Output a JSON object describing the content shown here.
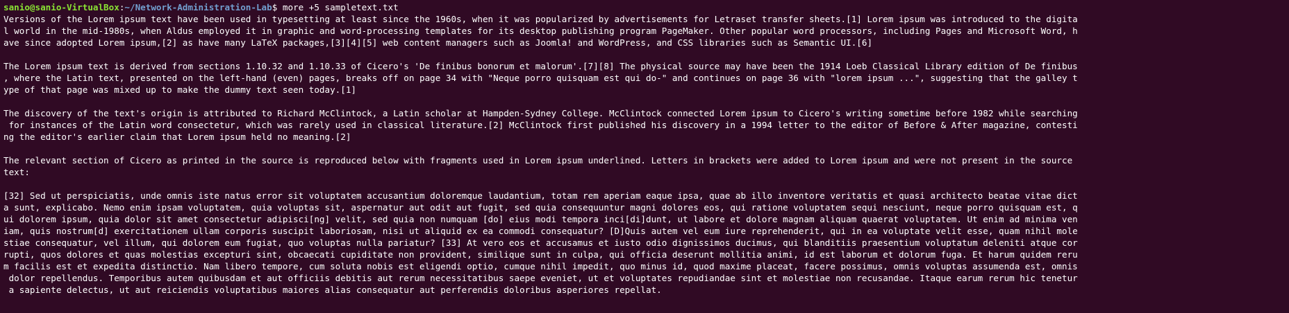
{
  "terminal": {
    "prompt": {
      "user_host": "sanio@sanio-VirtualBox",
      "separator": ":",
      "path": "~/Network-Administration-Lab",
      "dollar": "$ ",
      "command": "more +5 sampletext.txt"
    },
    "output_lines": [
      "Versions of the Lorem ipsum text have been used in typesetting at least since the 1960s, when it was popularized by advertisements for Letraset transfer sheets.[1] Lorem ipsum was introduced to the digita",
      "l world in the mid-1980s, when Aldus employed it in graphic and word-processing templates for its desktop publishing program PageMaker. Other popular word processors, including Pages and Microsoft Word, h",
      "ave since adopted Lorem ipsum,[2] as have many LaTeX packages,[3][4][5] web content managers such as Joomla! and WordPress, and CSS libraries such as Semantic UI.[6]",
      "",
      "The Lorem ipsum text is derived from sections 1.10.32 and 1.10.33 of Cicero's 'De finibus bonorum et malorum'.[7][8] The physical source may have been the 1914 Loeb Classical Library edition of De finibus",
      ", where the Latin text, presented on the left-hand (even) pages, breaks off on page 34 with \"Neque porro quisquam est qui do-\" and continues on page 36 with \"lorem ipsum ...\", suggesting that the galley t",
      "ype of that page was mixed up to make the dummy text seen today.[1]",
      "",
      "The discovery of the text's origin is attributed to Richard McClintock, a Latin scholar at Hampden-Sydney College. McClintock connected Lorem ipsum to Cicero's writing sometime before 1982 while searching",
      " for instances of the Latin word consectetur, which was rarely used in classical literature.[2] McClintock first published his discovery in a 1994 letter to the editor of Before & After magazine, contesti",
      "ng the editor's earlier claim that Lorem ipsum held no meaning.[2]",
      "",
      "The relevant section of Cicero as printed in the source is reproduced below with fragments used in Lorem ipsum underlined. Letters in brackets were added to Lorem ipsum and were not present in the source",
      "text:",
      "",
      "[32] Sed ut perspiciatis, unde omnis iste natus error sit voluptatem accusantium doloremque laudantium, totam rem aperiam eaque ipsa, quae ab illo inventore veritatis et quasi architecto beatae vitae dict",
      "a sunt, explicabo. Nemo enim ipsam voluptatem, quia voluptas sit, aspernatur aut odit aut fugit, sed quia consequuntur magni dolores eos, qui ratione voluptatem sequi nesciunt, neque porro quisquam est, q",
      "ui dolorem ipsum, quia dolor sit amet consectetur adipisci[ng] velit, sed quia non numquam [do] eius modi tempora inci[di]dunt, ut labore et dolore magnam aliquam quaerat voluptatem. Ut enim ad minima ven",
      "iam, quis nostrum[d] exercitationem ullam corporis suscipit laboriosam, nisi ut aliquid ex ea commodi consequatur? [D]Quis autem vel eum iure reprehenderit, qui in ea voluptate velit esse, quam nihil mole",
      "stiae consequatur, vel illum, qui dolorem eum fugiat, quo voluptas nulla pariatur? [33] At vero eos et accusamus et iusto odio dignissimos ducimus, qui blanditiis praesentium voluptatum deleniti atque cor",
      "rupti, quos dolores et quas molestias excepturi sint, obcaecati cupiditate non provident, similique sunt in culpa, qui officia deserunt mollitia animi, id est laborum et dolorum fuga. Et harum quidem reru",
      "m facilis est et expedita distinctio. Nam libero tempore, cum soluta nobis est eligendi optio, cumque nihil impedit, quo minus id, quod maxime placeat, facere possimus, omnis voluptas assumenda est, omnis",
      " dolor repellendus. Temporibus autem quibusdam et aut officiis debitis aut rerum necessitatibus saepe eveniet, ut et voluptates repudiandae sint et molestiae non recusandae. Itaque earum rerum hic tenetur",
      " a sapiente delectus, ut aut reiciendis voluptatibus maiores alias consequatur aut perferendis doloribus asperiores repellat."
    ]
  },
  "colors": {
    "background": "#300a24",
    "text": "#ffffff",
    "prompt_user": "#8ae234",
    "prompt_path": "#729fcf"
  }
}
